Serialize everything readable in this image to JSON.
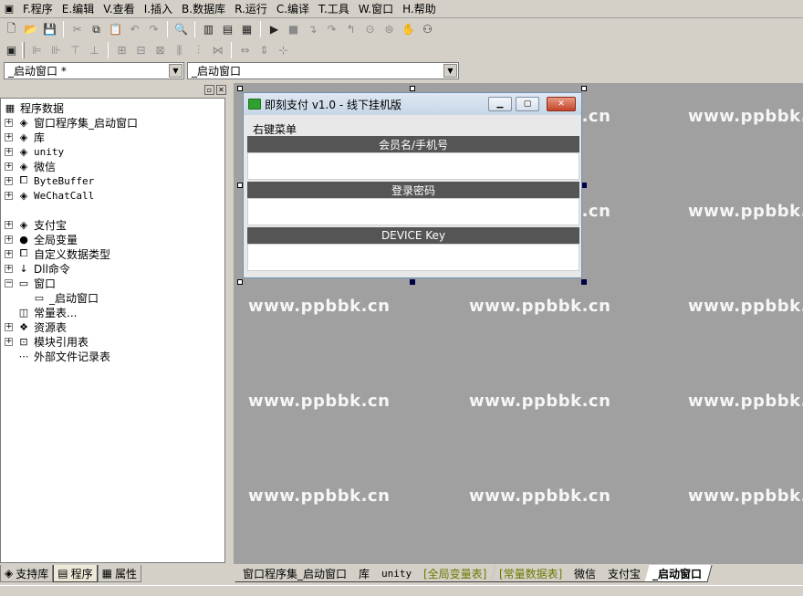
{
  "menubar": {
    "items": [
      {
        "label": "F.程序"
      },
      {
        "label": "E.编辑"
      },
      {
        "label": "V.查看"
      },
      {
        "label": "I.插入"
      },
      {
        "label": "B.数据库"
      },
      {
        "label": "R.运行"
      },
      {
        "label": "C.编译"
      },
      {
        "label": "T.工具"
      },
      {
        "label": "W.窗口"
      },
      {
        "label": "H.帮助"
      }
    ]
  },
  "combos": {
    "left_value": "_启动窗口 *",
    "right_value": "_启动窗口"
  },
  "tree": {
    "root": "程序数据",
    "items": [
      {
        "label": "窗口程序集_启动窗口"
      },
      {
        "label": "库"
      },
      {
        "label": "unity"
      },
      {
        "label": "微信"
      },
      {
        "label": "ByteBuffer"
      },
      {
        "label": "WeChatCall"
      },
      {
        "label": "支付宝"
      },
      {
        "label": "全局变量"
      },
      {
        "label": "自定义数据类型"
      },
      {
        "label": "Dll命令"
      },
      {
        "label": "窗口"
      },
      {
        "label": "_启动窗口"
      },
      {
        "label": "常量表..."
      },
      {
        "label": "资源表"
      },
      {
        "label": "模块引用表"
      },
      {
        "label": "外部文件记录表"
      }
    ]
  },
  "left_tabs": [
    {
      "label": "支持库"
    },
    {
      "label": "程序"
    },
    {
      "label": "属性"
    }
  ],
  "form": {
    "title": "即刻支付 v1.0 - 线下挂机版",
    "menu": "右键菜单",
    "label1": "会员名/手机号",
    "label2": "登录密码",
    "label3": "DEVICE Key"
  },
  "watermark": "www.ppbbk.cn",
  "design_tabs": [
    {
      "label": "窗口程序集_启动窗口"
    },
    {
      "label": "库"
    },
    {
      "label": "unity"
    },
    {
      "label": "[全局变量表]"
    },
    {
      "label": "[常量数据表]"
    },
    {
      "label": "微信"
    },
    {
      "label": "支付宝"
    },
    {
      "label": "_启动窗口"
    }
  ]
}
